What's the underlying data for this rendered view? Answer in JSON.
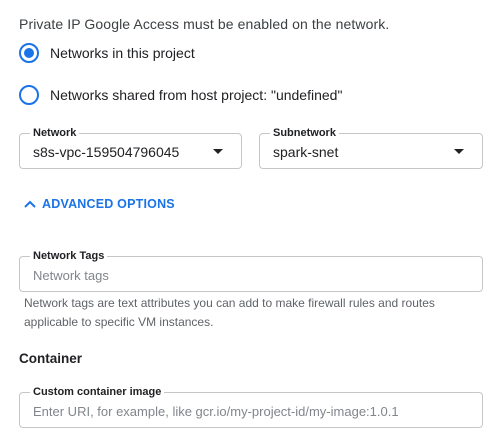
{
  "network_section": {
    "info_text": "Private IP Google Access must be enabled on the network.",
    "radio_this_project": {
      "label": "Networks in this project",
      "checked": true
    },
    "radio_shared": {
      "label": "Networks shared from host project: \"undefined\"",
      "checked": false
    },
    "network": {
      "label": "Network",
      "value": "s8s-vpc-159504796045"
    },
    "subnetwork": {
      "label": "Subnetwork",
      "value": "spark-snet"
    }
  },
  "advanced": {
    "toggle_label": "ADVANCED OPTIONS",
    "expanded": true,
    "network_tags": {
      "label": "Network Tags",
      "placeholder": "Network tags",
      "value": "",
      "helper": "Network tags are text attributes you can add to make firewall rules and routes applicable to specific VM instances."
    }
  },
  "container": {
    "title": "Container",
    "custom_image": {
      "label": "Custom container image",
      "placeholder": "Enter URI, for example, like gcr.io/my-project-id/my-image:1.0.1",
      "value": ""
    }
  },
  "colors": {
    "accent": "#1a73e8",
    "border": "#c4c7c5",
    "text": "#202124",
    "secondary_text": "#5f6368"
  },
  "icons": {
    "dropdown": "arrow-drop-down-icon",
    "expand": "chevron-up-icon"
  }
}
